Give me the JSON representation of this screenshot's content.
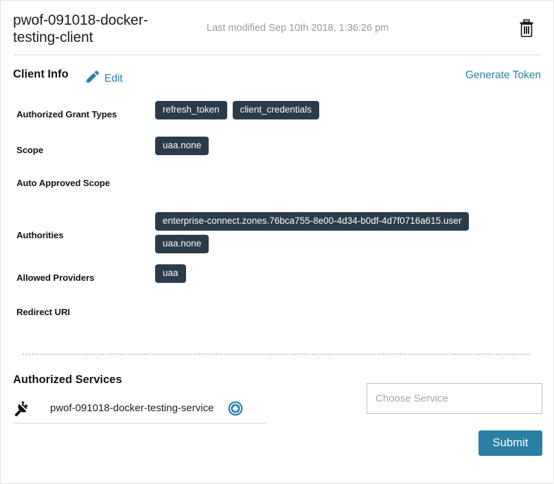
{
  "header": {
    "title": "pwof-091018-docker-testing-client",
    "last_modified": "Last modified Sep 10th 2018, 1:36:26 pm",
    "delete_icon": "trash-icon"
  },
  "client_info": {
    "section_title": "Client Info",
    "edit_label": "Edit",
    "edit_icon": "pencil-icon",
    "generate_token_label": "Generate Token"
  },
  "fields": [
    {
      "label": "Authorized Grant Types",
      "values": [
        "refresh_token",
        "client_credentials"
      ]
    },
    {
      "label": "Scope",
      "values": [
        "uaa.none"
      ]
    },
    {
      "label": "Auto Approved Scope",
      "values": []
    },
    {
      "label": "Authorities",
      "values": [
        "enterprise-connect.zones.76bca755-8e00-4d34-b0df-4d7f0716a615.user",
        "uaa.none"
      ]
    },
    {
      "label": "Allowed Providers",
      "values": [
        "uaa"
      ]
    },
    {
      "label": "Redirect URI",
      "values": []
    }
  ],
  "authorized_services": {
    "section_title": "Authorized Services",
    "items": [
      {
        "name": "pwof-091018-docker-testing-service",
        "icon": "plug-icon",
        "remove_icon": "remove-circle-icon"
      }
    ],
    "choose_service_placeholder": "Choose Service",
    "choose_service_value": "",
    "submit_label": "Submit"
  },
  "colors": {
    "accent_blue": "#2b7fa5",
    "tag_background": "#2b3b4a",
    "tag_text": "#fdfdfd",
    "muted_text": "#9b9b9b",
    "card_background": "#ffffff"
  }
}
